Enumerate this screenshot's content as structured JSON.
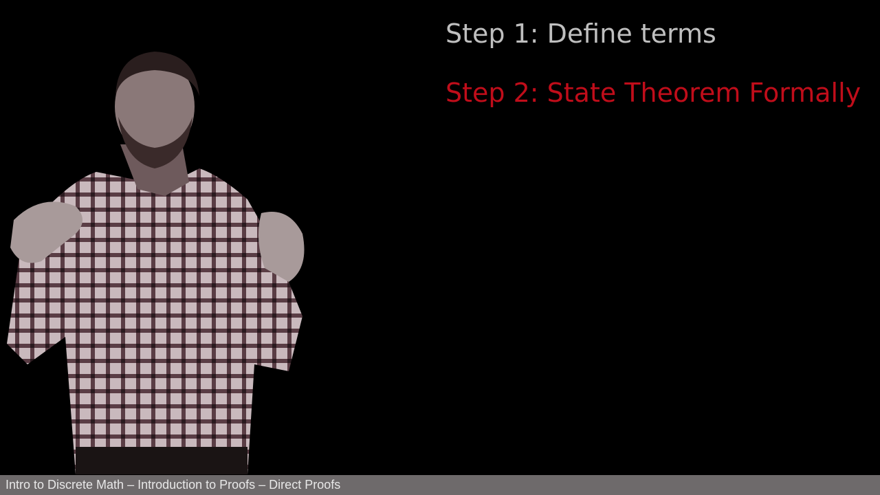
{
  "slide": {
    "steps": [
      {
        "label": "Step 1: Define terms",
        "color": "#bfbfbf"
      },
      {
        "label": "Step 2: State Theorem Formally",
        "color": "#c00d1a"
      }
    ]
  },
  "footer": {
    "text": "Intro to Discrete Math – Introduction to Proofs – Direct Proofs",
    "background": "#6e6a6b"
  }
}
